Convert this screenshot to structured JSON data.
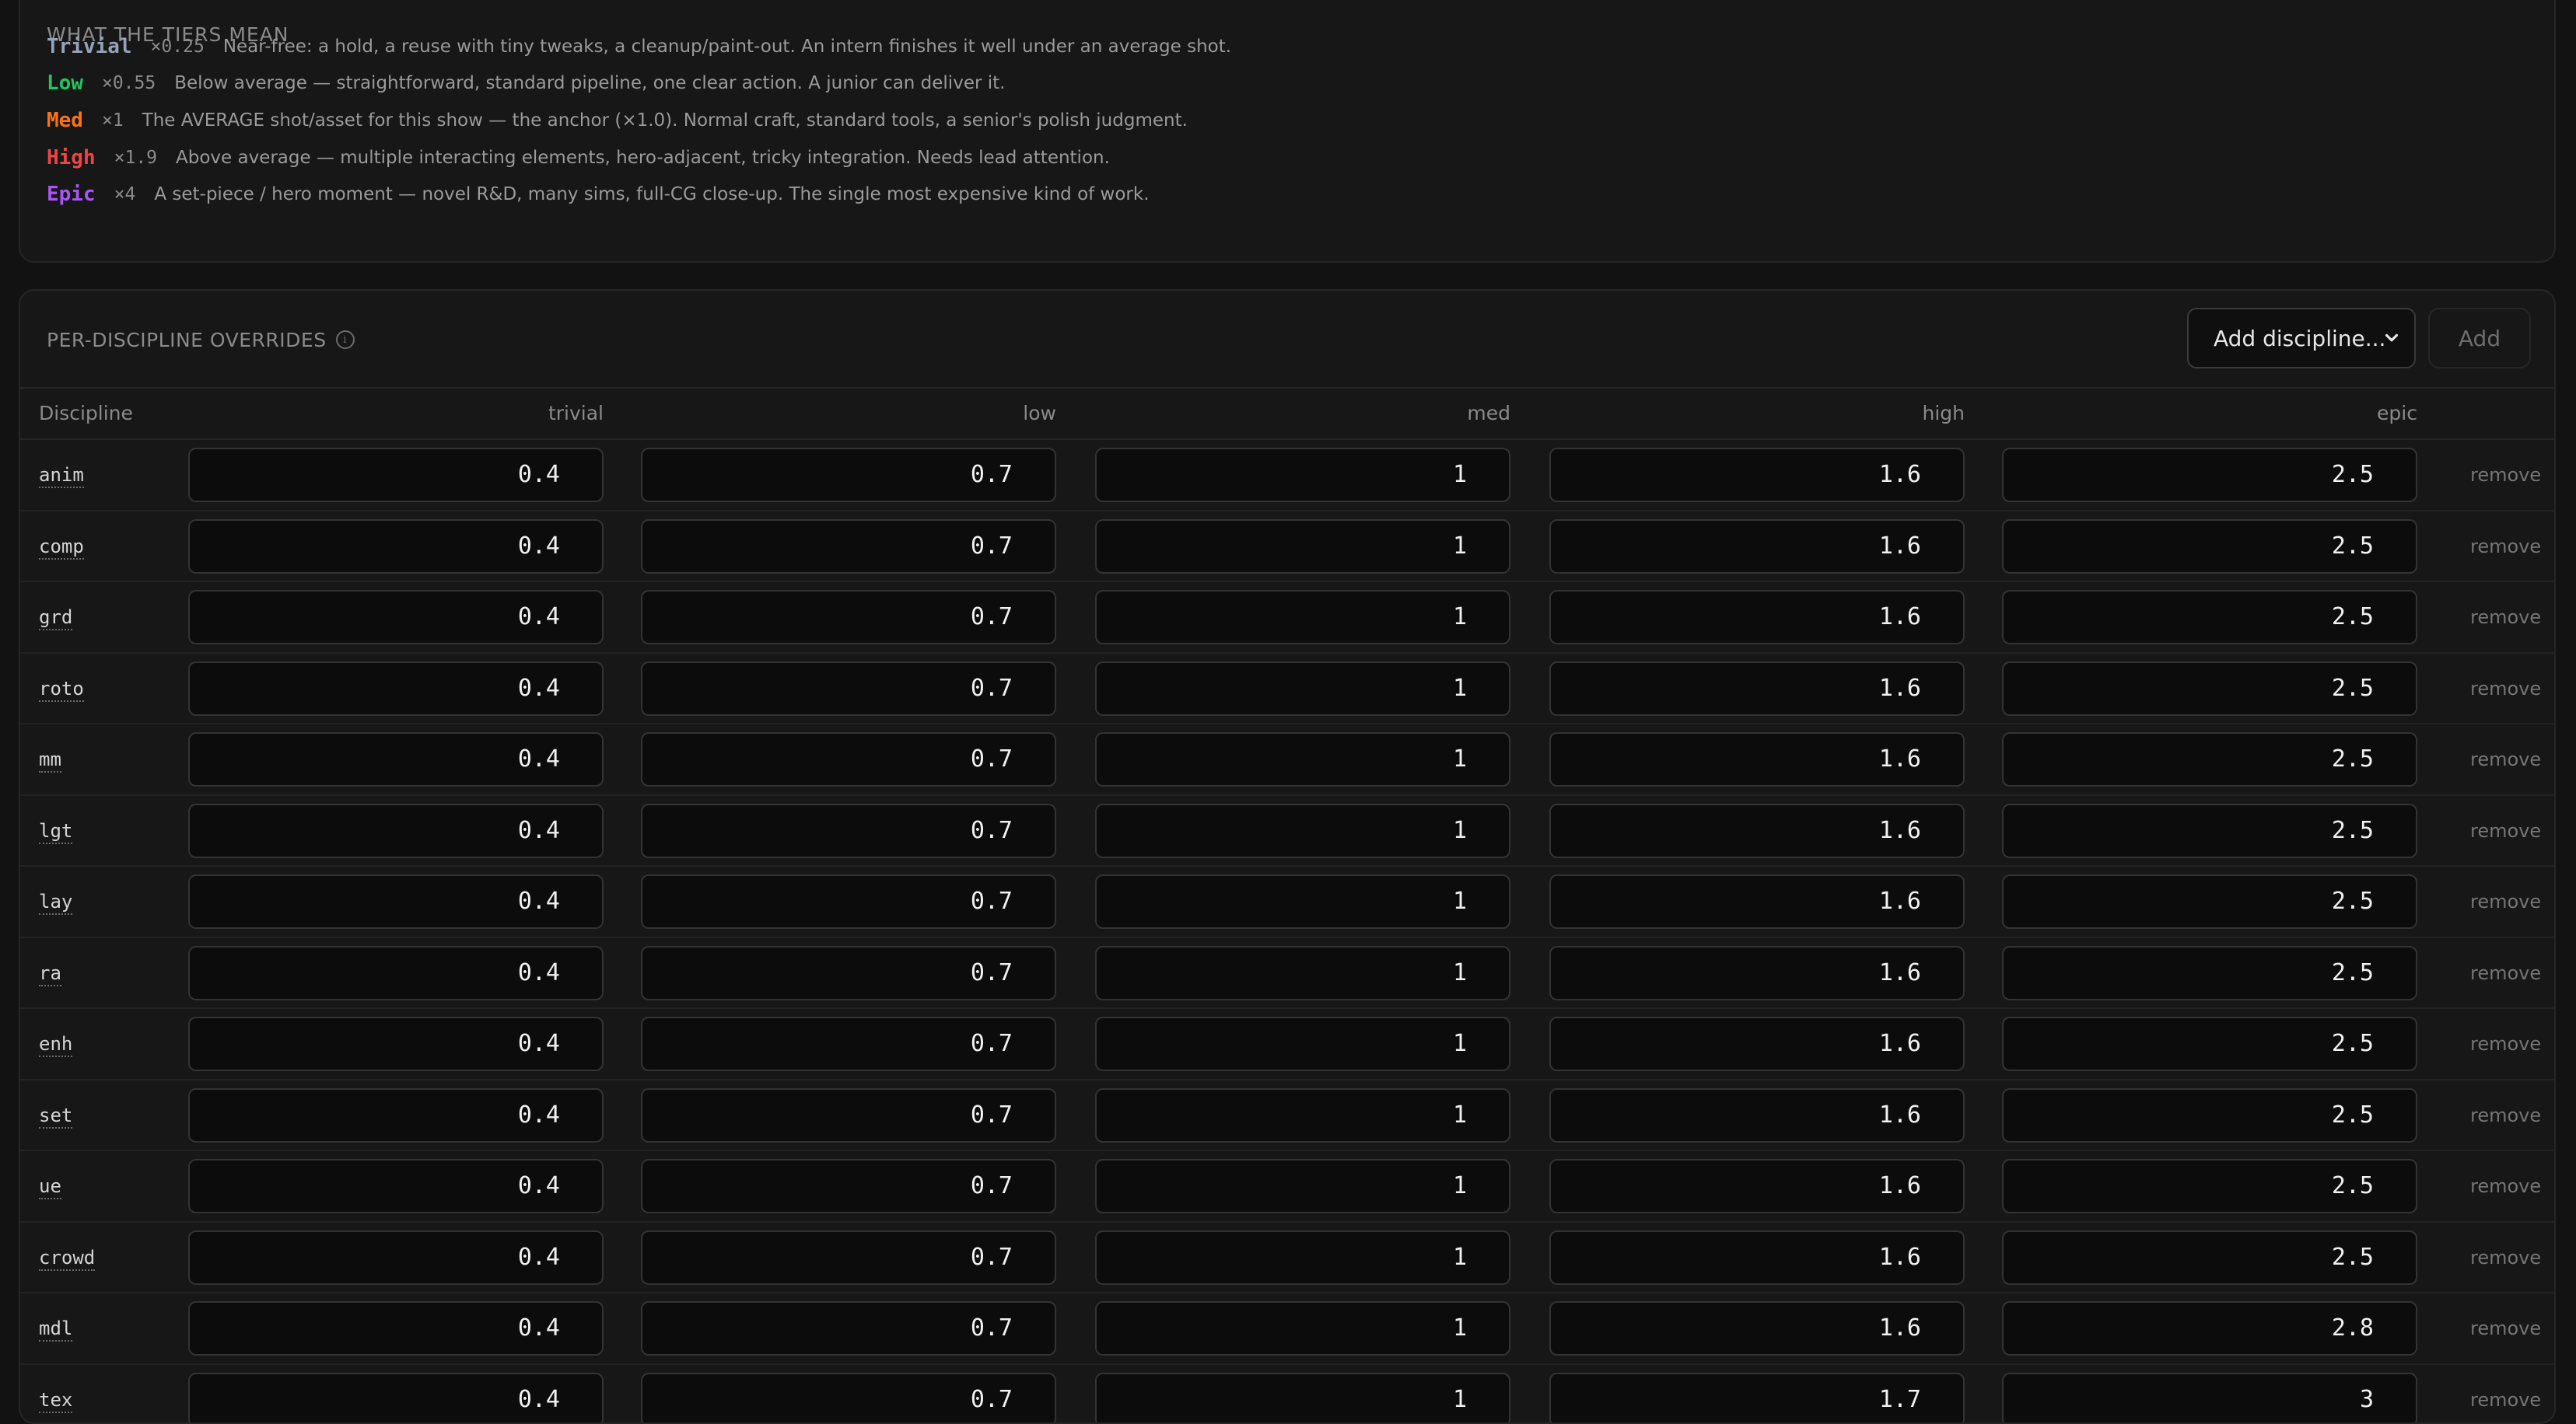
{
  "tiers": {
    "title": "WHAT THE TIERS MEAN",
    "items": [
      {
        "name": "Trivial",
        "mult": "×0.25",
        "desc": "Near-free: a hold, a reuse with tiny tweaks, a cleanup/paint-out. An intern finishes it well under an average shot.",
        "color": "#94a3b8"
      },
      {
        "name": "Low",
        "mult": "×0.55",
        "desc": "Below average — straightforward, standard pipeline, one clear action. A junior can deliver it.",
        "color": "#22c55e"
      },
      {
        "name": "Med",
        "mult": "×1",
        "desc": "The AVERAGE shot/asset for this show — the anchor (×1.0). Normal craft, standard tools, a senior's polish judgment.",
        "color": "#f97316"
      },
      {
        "name": "High",
        "mult": "×1.9",
        "desc": "Above average — multiple interacting elements, hero-adjacent, tricky integration. Needs lead attention.",
        "color": "#ef4444"
      },
      {
        "name": "Epic",
        "mult": "×4",
        "desc": "A set-piece / hero moment — novel R&D, many sims, full-CG close-up. The single most expensive kind of work.",
        "color": "#a855f7"
      }
    ]
  },
  "overrides": {
    "title": "PER-DISCIPLINE OVERRIDES",
    "select_label": "Add discipline...",
    "add_label": "Add",
    "remove_label": "remove",
    "columns": [
      "Discipline",
      "trivial",
      "low",
      "med",
      "high",
      "epic"
    ],
    "rows": [
      {
        "name": "anim",
        "values": [
          "0.4",
          "0.7",
          "1",
          "1.6",
          "2.5"
        ]
      },
      {
        "name": "comp",
        "values": [
          "0.4",
          "0.7",
          "1",
          "1.6",
          "2.5"
        ]
      },
      {
        "name": "grd",
        "values": [
          "0.4",
          "0.7",
          "1",
          "1.6",
          "2.5"
        ]
      },
      {
        "name": "roto",
        "values": [
          "0.4",
          "0.7",
          "1",
          "1.6",
          "2.5"
        ]
      },
      {
        "name": "mm",
        "values": [
          "0.4",
          "0.7",
          "1",
          "1.6",
          "2.5"
        ]
      },
      {
        "name": "lgt",
        "values": [
          "0.4",
          "0.7",
          "1",
          "1.6",
          "2.5"
        ]
      },
      {
        "name": "lay",
        "values": [
          "0.4",
          "0.7",
          "1",
          "1.6",
          "2.5"
        ]
      },
      {
        "name": "ra",
        "values": [
          "0.4",
          "0.7",
          "1",
          "1.6",
          "2.5"
        ]
      },
      {
        "name": "enh",
        "values": [
          "0.4",
          "0.7",
          "1",
          "1.6",
          "2.5"
        ]
      },
      {
        "name": "set",
        "values": [
          "0.4",
          "0.7",
          "1",
          "1.6",
          "2.5"
        ]
      },
      {
        "name": "ue",
        "values": [
          "0.4",
          "0.7",
          "1",
          "1.6",
          "2.5"
        ]
      },
      {
        "name": "crowd",
        "values": [
          "0.4",
          "0.7",
          "1",
          "1.6",
          "2.5"
        ]
      },
      {
        "name": "mdl",
        "values": [
          "0.4",
          "0.7",
          "1",
          "1.6",
          "2.8"
        ]
      },
      {
        "name": "tex",
        "values": [
          "0.4",
          "0.7",
          "1",
          "1.7",
          "3"
        ]
      }
    ]
  }
}
